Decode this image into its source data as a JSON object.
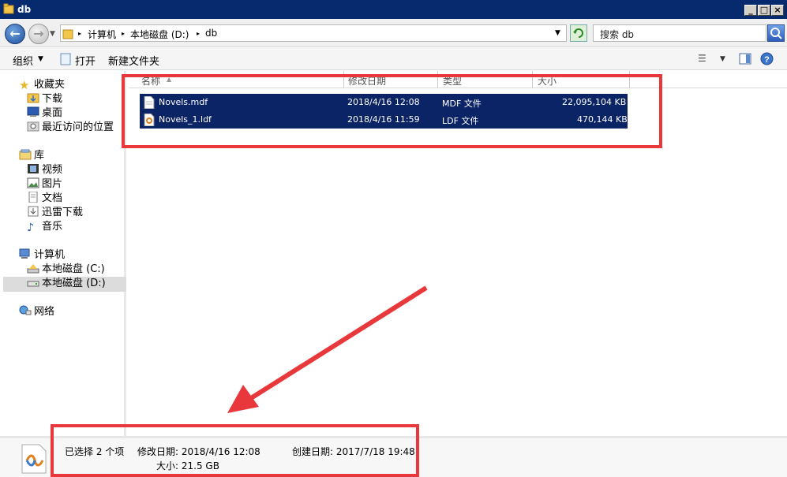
{
  "window": {
    "title": "db"
  },
  "address": {
    "path": [
      "计算机",
      "本地磁盘 (D:)",
      "db"
    ],
    "search_placeholder": "搜索 db"
  },
  "toolbar": {
    "organize": "组织",
    "open": "打开",
    "new_folder": "新建文件夹"
  },
  "sidebar": {
    "favorites": "收藏夹",
    "downloads": "下载",
    "desktop": "桌面",
    "recent": "最近访问的位置",
    "libraries": "库",
    "videos": "视频",
    "pictures": "图片",
    "documents": "文档",
    "xunlei": "迅雷下载",
    "music": "音乐",
    "computer": "计算机",
    "drive_c": "本地磁盘 (C:)",
    "drive_d": "本地磁盘 (D:)",
    "network": "网络"
  },
  "columns": {
    "name": "名称",
    "modified": "修改日期",
    "type": "类型",
    "size": "大小"
  },
  "files": [
    {
      "name": "Novels.mdf",
      "modified": "2018/4/16 12:08",
      "type": "MDF 文件",
      "size": "22,095,104 KB"
    },
    {
      "name": "Novels_1.ldf",
      "modified": "2018/4/16 11:59",
      "type": "LDF 文件",
      "size": "470,144 KB"
    }
  ],
  "details": {
    "selected": "已选择 2 个项",
    "modified": "修改日期: 2018/4/16 12:08",
    "created": "创建日期: 2017/7/18 19:48",
    "size": "大小: 21.5 GB"
  },
  "colors": {
    "selection": "#0b2466",
    "annotation": "#e8383b",
    "titlebar": "#072a6f"
  }
}
